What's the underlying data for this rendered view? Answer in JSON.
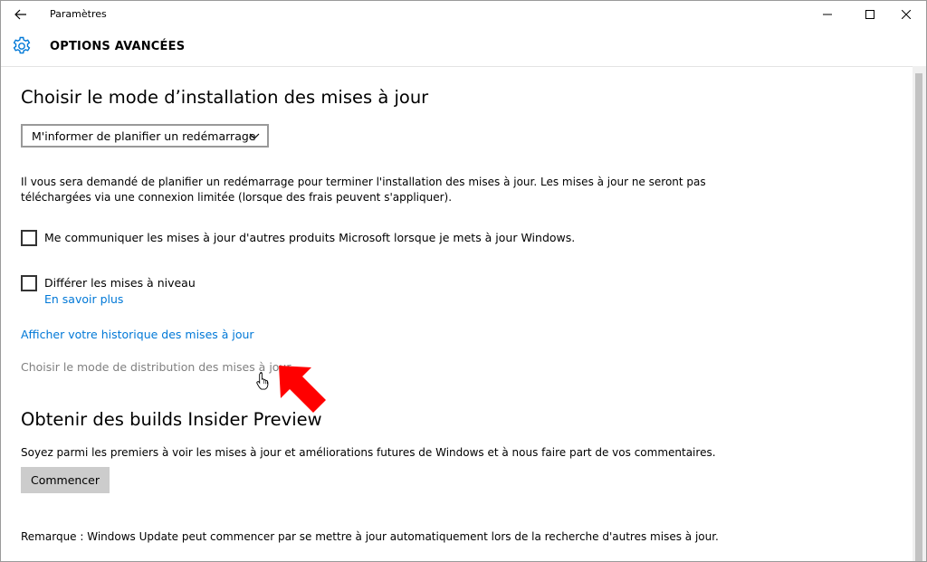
{
  "window": {
    "title": "Paramètres",
    "controls": [
      "minimize-icon",
      "maximize-icon",
      "close-icon"
    ]
  },
  "header": {
    "title": "OPTIONS AVANCÉES",
    "icon": "gear-icon",
    "accent_color": "#0078d7"
  },
  "install_section": {
    "heading": "Choisir le mode d’installation des mises à jour",
    "dropdown_value": "M'informer de planifier un redémarrage",
    "description": "Il vous sera demandé de planifier un redémarrage pour terminer l'installation des mises à jour. Les mises à jour ne seront pas téléchargées via une connexion limitée (lorsque des frais peuvent s'appliquer).",
    "checkbox_other_products": {
      "label": "Me communiquer les mises à jour d'autres produits Microsoft lorsque je mets à jour Windows.",
      "checked": false
    },
    "checkbox_defer": {
      "label": "Différer les mises à niveau",
      "checked": false
    },
    "learn_more": "En savoir plus",
    "history_link": "Afficher votre historique des mises à jour",
    "delivery_link": "Choisir le mode de distribution des mises à jour"
  },
  "insider_section": {
    "heading": "Obtenir des builds Insider Preview",
    "description": "Soyez parmi les premiers à voir les mises à jour et améliorations futures de Windows et à nous faire part de vos commentaires.",
    "button": "Commencer"
  },
  "note": "Remarque : Windows Update peut commencer par se mettre à jour automatiquement lors de la recherche d'autres mises à jour.",
  "annotation": {
    "arrow_color": "#ff0000"
  }
}
